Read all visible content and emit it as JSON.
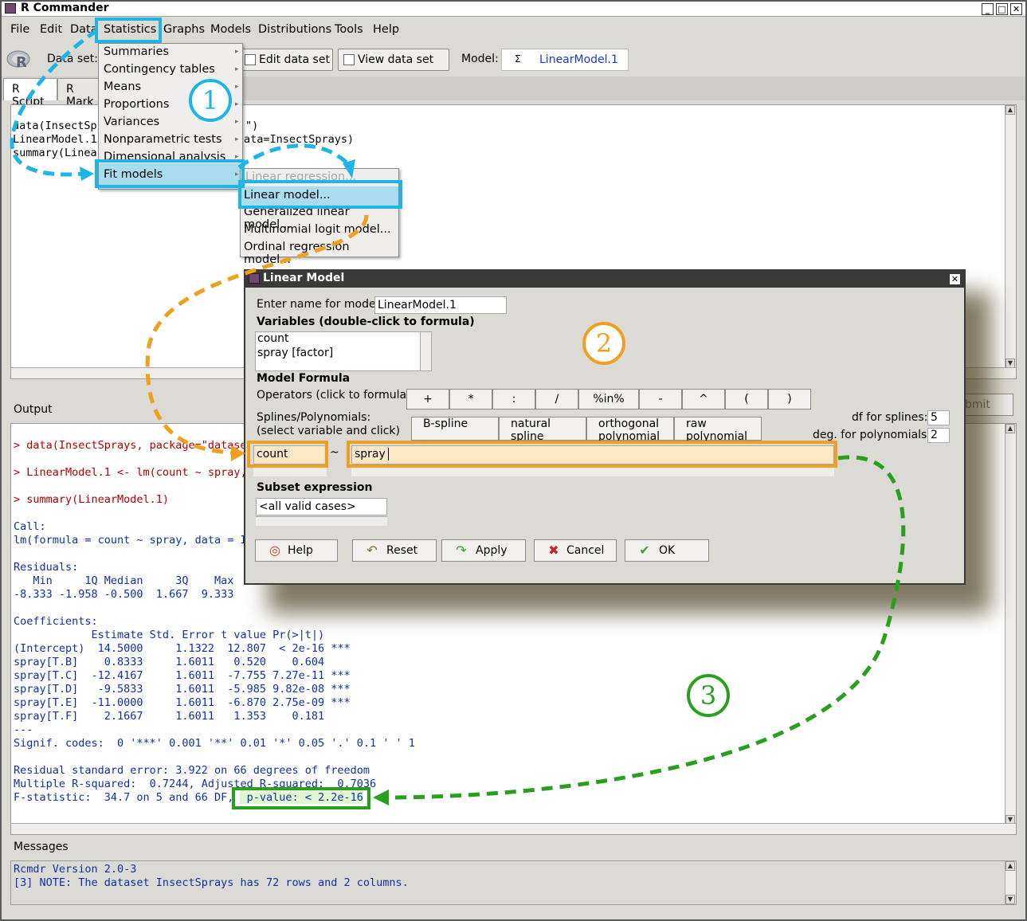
{
  "window": {
    "title": "R Commander",
    "buttons": [
      "_",
      "□",
      "✕"
    ]
  },
  "menubar": {
    "items": [
      "File",
      "Edit",
      "Data",
      "Statistics",
      "Graphs",
      "Models",
      "Distributions",
      "Tools",
      "Help"
    ]
  },
  "toolbar": {
    "dataset_label": "Data set:",
    "edit_data_set": "Edit data set",
    "view_data_set": "View data set",
    "model_label": "Model:",
    "model_sigma": "Σ",
    "model_value": "LinearModel.1"
  },
  "tabs": [
    "R Script",
    "R Mark"
  ],
  "script": {
    "lines": [
      "data(InsectSpr",
      "LinearModel.1",
      "summary(Linear"
    ],
    "tails": [
      "\")",
      "ata=InsectSprays)"
    ]
  },
  "statistics_menu": {
    "items": [
      "Summaries",
      "Contingency tables",
      "Means",
      "Proportions",
      "Variances",
      "Nonparametric tests",
      "Dimensional analysis",
      "Fit models"
    ]
  },
  "fit_models_submenu": {
    "items": [
      "Linear regression...",
      "Linear model...",
      "Generalized linear model...",
      "Multinomial logit model...",
      "Ordinal regression model..."
    ]
  },
  "output": {
    "label": "Output",
    "submit_partial": "bmit",
    "commands": [
      "> data(InsectSprays, package=\"datase",
      "> LinearModel.1 <- lm(count ~ spray,",
      "> summary(LinearModel.1)"
    ],
    "lines": [
      "Call:",
      "lm(formula = count ~ spray, data = I",
      "",
      "Residuals:",
      "   Min     1Q Median     3Q    Max",
      "-8.333 -1.958 -0.500  1.667  9.333",
      "",
      "Coefficients:",
      "            Estimate Std. Error t value Pr(>|t|)",
      "(Intercept)  14.5000     1.1322  12.807  < 2e-16 ***",
      "spray[T.B]    0.8333     1.6011   0.520    0.604",
      "spray[T.C]  -12.4167     1.6011  -7.755 7.27e-11 ***",
      "spray[T.D]   -9.5833     1.6011  -5.985 9.82e-08 ***",
      "spray[T.E]  -11.0000     1.6011  -6.870 2.75e-09 ***",
      "spray[T.F]    2.1667     1.6011   1.353    0.181",
      "---",
      "Signif. codes:  0 '***' 0.001 '**' 0.01 '*' 0.05 '.' 0.1 ' ' 1",
      "",
      "Residual standard error: 3.922 on 66 degrees of freedom",
      "Multiple R-squared:  0.7244, Adjusted R-squared:  0.7036"
    ],
    "fstat_prefix": "F-statistic:  34.7 on 5 and 66 DF, ",
    "pvalue": " p-value: < 2.2e-16"
  },
  "messages": {
    "label": "Messages",
    "lines": [
      "Rcmdr Version 2.0-3",
      "[3] NOTE: The dataset InsectSprays has 72 rows and 2 columns."
    ]
  },
  "dialog": {
    "title": "Linear Model",
    "model_name_label": "Enter name for model:",
    "model_name_value": "LinearModel.1",
    "variables_header": "Variables (double-click to formula)",
    "variables": [
      "count",
      "spray [factor]"
    ],
    "formula_header": "Model Formula",
    "operators_label": "Operators (click to formula):",
    "operators": [
      "+",
      "*",
      ":",
      "/",
      "%in%",
      "-",
      "^",
      "(",
      ")"
    ],
    "splines_label_1": "Splines/Polynomials:",
    "splines_label_2": "(select variable and click)",
    "spline_buttons": [
      [
        "B-spline",
        ""
      ],
      [
        "natural",
        "spline"
      ],
      [
        "orthogonal",
        "polynomial"
      ],
      [
        "raw",
        "polynomial"
      ]
    ],
    "df_splines_label": "df for splines:",
    "df_splines_value": "5",
    "deg_poly_label": "deg. for polynomials:",
    "deg_poly_value": "2",
    "lhs": "count",
    "tilde": "~",
    "rhs": "spray",
    "subset_header": "Subset expression",
    "subset_value": "<all valid cases>",
    "buttons": {
      "help": "Help",
      "reset": "Reset",
      "apply": "Apply",
      "cancel": "Cancel",
      "ok": "OK"
    }
  },
  "annotations": {
    "badges": [
      "1",
      "2",
      "3"
    ],
    "colors": {
      "step1": "#1eb4e6",
      "step2": "#f0a01e",
      "step3": "#28a01e"
    }
  }
}
